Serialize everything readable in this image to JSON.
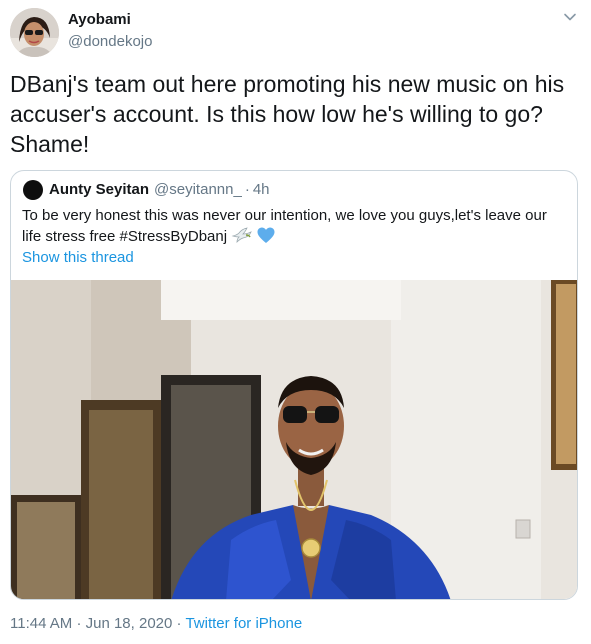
{
  "author": {
    "name": "Ayobami",
    "handle": "@dondekojo"
  },
  "tweet": {
    "text": "DBanj's team out here promoting his new music on his accuser's account. Is this how low he's willing to go? Shame!"
  },
  "quoted": {
    "name": "Aunty Seyitan",
    "handle": "@seyitannn_",
    "separator": "·",
    "time": "4h",
    "text": "To be very honest this was never our intention, we love you guys,let's leave our life stress free #StressByDbanj",
    "emojis": [
      "dove-icon",
      "blue-heart-icon"
    ],
    "show_thread": "Show this thread",
    "image_alt_colors": {
      "jacket": "#2a4fbf",
      "wall": "#ebe7e2"
    }
  },
  "meta": {
    "time": "11:44 AM",
    "separator": "·",
    "date": "Jun 18, 2020",
    "source": "Twitter for iPhone"
  },
  "colors": {
    "link": "#1b95e0",
    "secondary": "#657786",
    "border": "#ccd6dd"
  }
}
